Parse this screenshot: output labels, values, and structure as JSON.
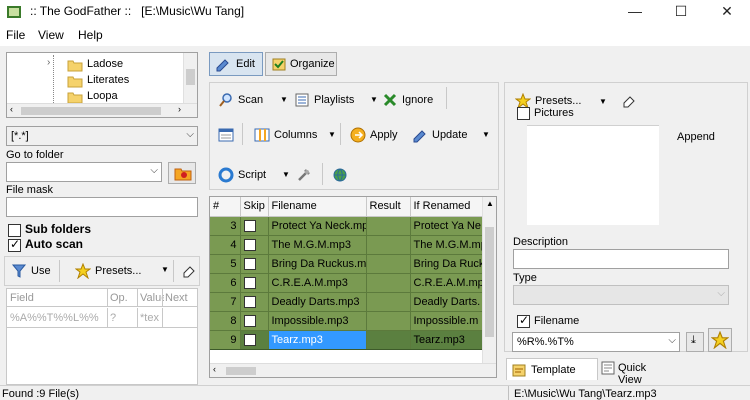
{
  "window": {
    "title": ":: The GodFather ::   [E:\\Music\\Wu Tang]"
  },
  "menu": {
    "file": "File",
    "view": "View",
    "help": "Help"
  },
  "left": {
    "tree": [
      "Ladose",
      "Literates",
      "Loopa"
    ],
    "filter_value": "[*.*]",
    "goto_label": "Go to folder",
    "goto_value": "",
    "mask_label": "File mask",
    "mask_value": "",
    "subfolders_label": "Sub folders",
    "subfolders_checked": false,
    "autoscan_label": "Auto scan",
    "autoscan_checked": true,
    "use_label": "Use",
    "presets_label": "Presets...",
    "map_headers": [
      "Field",
      "Op.",
      "Value",
      "Next"
    ],
    "map_row": [
      "%A%%T%%L%%",
      "?",
      "*tex",
      ""
    ]
  },
  "center": {
    "tab_edit": "Edit",
    "tab_organize": "Organize",
    "scan_label": "Scan",
    "playlists_label": "Playlists",
    "ignore_label": "Ignore",
    "columns_label": "Columns",
    "apply_label": "Apply",
    "update_label": "Update",
    "script_label": "Script",
    "grid_headers": [
      "#",
      "Skip",
      "Filename",
      "Result",
      "If Renamed"
    ],
    "rows": [
      {
        "num": "3",
        "filename": "Protect Ya Neck.mp",
        "result": "",
        "renamed": "Protect Ya Ne"
      },
      {
        "num": "4",
        "filename": "The M.G.M.mp3",
        "result": "",
        "renamed": "The M.G.M.mp"
      },
      {
        "num": "5",
        "filename": "Bring Da Ruckus.mp",
        "result": "",
        "renamed": "Bring Da Ruck"
      },
      {
        "num": "6",
        "filename": "C.R.E.A.M.mp3",
        "result": "",
        "renamed": "C.R.E.A.M.mp"
      },
      {
        "num": "7",
        "filename": "Deadly Darts.mp3",
        "result": "",
        "renamed": "Deadly Darts."
      },
      {
        "num": "8",
        "filename": "Impossible.mp3",
        "result": "",
        "renamed": "Impossible.m"
      },
      {
        "num": "9",
        "filename": "Tearz.mp3",
        "result": "",
        "renamed": "Tearz.mp3"
      }
    ]
  },
  "right": {
    "presets_label": "Presets...",
    "pictures_label": "Pictures",
    "append_label": "Append",
    "description_label": "Description",
    "type_label": "Type",
    "filename_label": "Filename",
    "filename_template": "%R%.%T%",
    "tab_template": "Template",
    "tab_quickview": "Quick View"
  },
  "status": {
    "left": "Found :9 File(s)",
    "right": "E:\\Music\\Wu Tang\\Tearz.mp3"
  }
}
